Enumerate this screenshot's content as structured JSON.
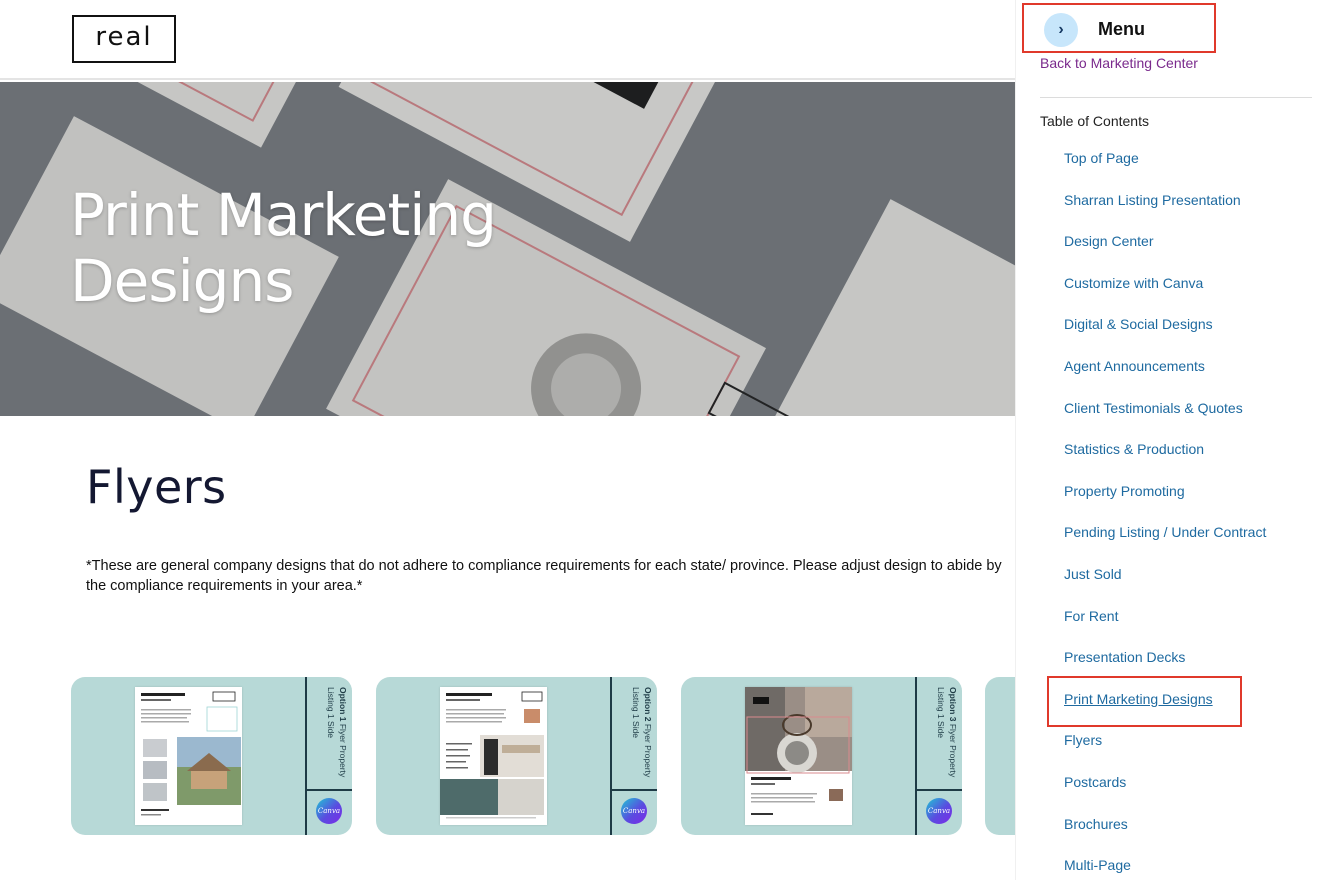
{
  "header": {
    "logo_text": "real"
  },
  "hero": {
    "title_line1": "Print Marketing",
    "title_line2": "Designs"
  },
  "main": {
    "section_title": "Flyers",
    "disclaimer": "*These are general company designs that do not adhere to compliance requirements for each state/ province. Please adjust design to abide by the compliance requirements in your area.*",
    "cards": [
      {
        "side_label": "Flyer Property Listing 1 Side",
        "option": "Option 1",
        "doc_logo": "real",
        "canva_label": "Canva"
      },
      {
        "side_label": "Flyer Property Listing 1 Side",
        "option": "Option 2",
        "doc_logo": "real",
        "canva_label": "Canva"
      },
      {
        "side_label": "Flyer Property Listing 1 Side",
        "option": "Option 3",
        "doc_logo": "real",
        "canva_label": "Canva"
      }
    ]
  },
  "sidebar": {
    "menu_label": "Menu",
    "toggle_icon": "chevron-right-icon",
    "back_link": "Back to Marketing Center",
    "toc_title": "Table of Contents",
    "items": [
      "Top of Page",
      "Sharran Listing Presentation",
      "Design Center",
      "Customize with Canva",
      "Digital & Social Designs",
      "Agent Announcements",
      "Client Testimonials & Quotes",
      "Statistics & Production",
      "Property Promoting",
      "Pending Listing / Under Contract",
      "Just Sold",
      "For Rent",
      "Presentation Decks",
      "Print Marketing Designs",
      "Flyers",
      "Postcards",
      "Brochures",
      "Multi-Page"
    ],
    "active_item": "Print Marketing Designs"
  },
  "colors": {
    "card_bg": "#b7d9d7",
    "link": "#1e6aa0",
    "visited_link": "#7a2a8c",
    "highlight_box": "#e0392b",
    "toggle_bg": "#c7e6fb"
  }
}
